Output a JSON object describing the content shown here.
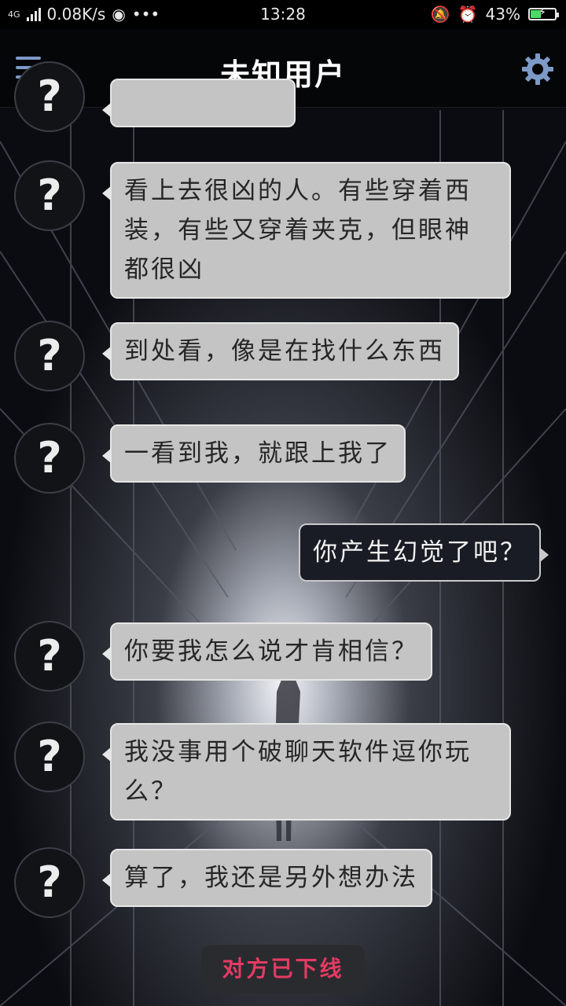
{
  "status_bar": {
    "network": "4G",
    "speed": "0.08K/s",
    "dots": "•••",
    "time": "13:28",
    "battery": "43%",
    "battery_level": 0.43
  },
  "header": {
    "title": "未知用户"
  },
  "messages": [
    {
      "from": "other",
      "avatar": "?",
      "text": ""
    },
    {
      "from": "other",
      "avatar": "?",
      "text": "看上去很凶的人。有些穿着西装，有些又穿着夹克，但眼神都很凶"
    },
    {
      "from": "other",
      "avatar": "?",
      "text": "到处看，像是在找什么东西"
    },
    {
      "from": "other",
      "avatar": "?",
      "text": "一看到我，就跟上我了"
    },
    {
      "from": "self",
      "text": "你产生幻觉了吧？"
    },
    {
      "from": "other",
      "avatar": "?",
      "text": "你要我怎么说才肯相信？"
    },
    {
      "from": "other",
      "avatar": "?",
      "text": "我没事用个破聊天软件逗你玩么？"
    },
    {
      "from": "other",
      "avatar": "?",
      "text": "算了，我还是另外想办法"
    }
  ],
  "offline_notice": "对方已下线",
  "colors": {
    "bubble_other": "#c4c4c4",
    "bubble_self": "#1a1c25",
    "accent": "#7d99c6",
    "offline_text": "#e53b63"
  }
}
